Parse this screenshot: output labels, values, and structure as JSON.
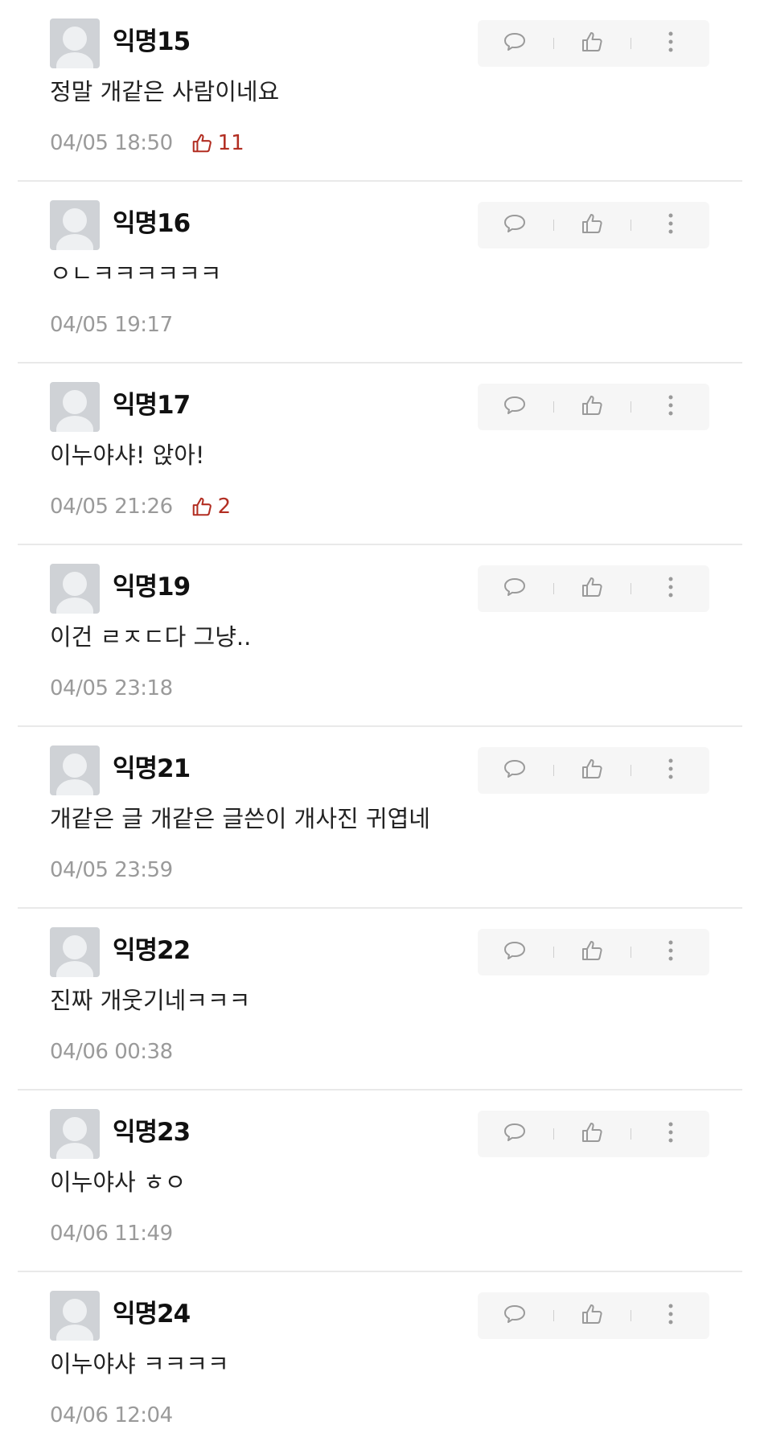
{
  "colors": {
    "like_accent": "#b22e22",
    "timestamp": "#9a9a9a",
    "action_bar_bg": "#f6f6f6",
    "divider": "#e9e9e9"
  },
  "icons": {
    "avatar": "default-user-avatar",
    "reply": "speech-bubble-icon",
    "like": "thumbs-up-icon",
    "more": "vertical-ellipsis-icon"
  },
  "comments": [
    {
      "username": "익명15",
      "text": "정말 개같은 사람이네요",
      "time": "04/05 18:50",
      "likes": "11"
    },
    {
      "username": "익명16",
      "text": "ㅇㄴㅋㅋㅋㅋㅋㅋ",
      "time": "04/05 19:17",
      "likes": ""
    },
    {
      "username": "익명17",
      "text": "이누야샤! 앉아!",
      "time": "04/05 21:26",
      "likes": "2"
    },
    {
      "username": "익명19",
      "text": "이건 ㄹㅈㄷ다 그냥..",
      "time": "04/05 23:18",
      "likes": ""
    },
    {
      "username": "익명21",
      "text": "개같은 글 개같은 글쓴이 개사진 귀엽네",
      "time": "04/05 23:59",
      "likes": ""
    },
    {
      "username": "익명22",
      "text": "진짜 개웃기네ㅋㅋㅋ",
      "time": "04/06 00:38",
      "likes": ""
    },
    {
      "username": "익명23",
      "text": "이누야사 ㅎㅇ",
      "time": "04/06 11:49",
      "likes": ""
    },
    {
      "username": "익명24",
      "text": "이누야샤 ㅋㅋㅋㅋ",
      "time": "04/06 12:04",
      "likes": ""
    }
  ]
}
